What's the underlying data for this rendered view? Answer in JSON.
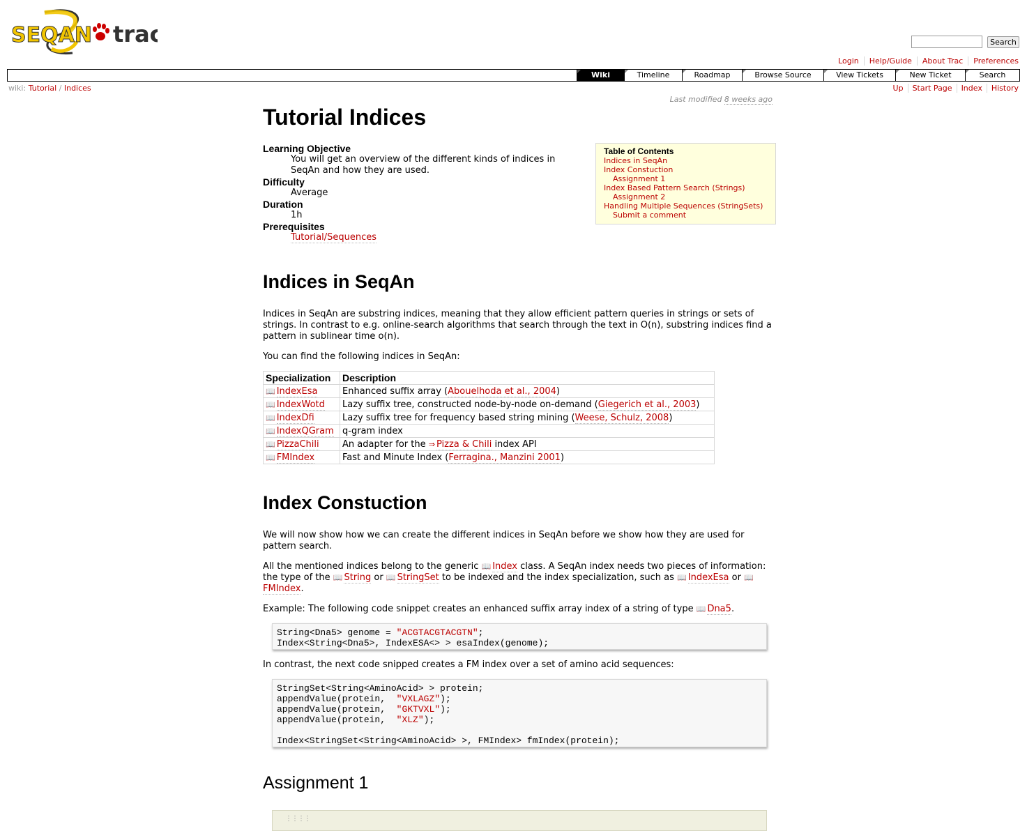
{
  "header": {
    "logo_text_left": "SEQAN",
    "logo_text_right": "trac",
    "search_placeholder": "",
    "search_button": "Search",
    "metanav": [
      "Login",
      "Help/Guide",
      "About Trac",
      "Preferences"
    ]
  },
  "mainnav": [
    {
      "label": "Wiki",
      "active": true
    },
    {
      "label": "Timeline",
      "active": false
    },
    {
      "label": "Roadmap",
      "active": false
    },
    {
      "label": "Browse Source",
      "active": false
    },
    {
      "label": "View Tickets",
      "active": false
    },
    {
      "label": "New Ticket",
      "active": false
    },
    {
      "label": "Search",
      "active": false
    }
  ],
  "breadcrumb": {
    "prefix": "wiki:",
    "items": [
      "Tutorial",
      "Indices"
    ],
    "separator": "/"
  },
  "ctxnav": [
    "Up",
    "Start Page",
    "Index",
    "History"
  ],
  "last_modified": {
    "prefix": "Last modified",
    "ago": "8 weeks ago"
  },
  "page_title": "Tutorial Indices",
  "objectives": [
    {
      "term": "Learning Objective",
      "def": "You will get an overview of the different kinds of indices in SeqAn and how they are used."
    },
    {
      "term": "Difficulty",
      "def": "Average"
    },
    {
      "term": "Duration",
      "def": "1h"
    },
    {
      "term": "Prerequisites",
      "def": "Tutorial/Sequences",
      "link": true
    }
  ],
  "toc": {
    "title": "Table of Contents",
    "items": [
      {
        "label": "Indices in SeqAn",
        "sub": false
      },
      {
        "label": "Index Constuction",
        "sub": false
      },
      {
        "label": "Assignment 1",
        "sub": true
      },
      {
        "label": "Index Based Pattern Search (Strings)",
        "sub": false
      },
      {
        "label": "Assignment 2",
        "sub": true
      },
      {
        "label": "Handling Multiple Sequences (StringSets)",
        "sub": false
      },
      {
        "label": "Submit a comment",
        "sub": true
      }
    ]
  },
  "section1": {
    "heading": "Indices in SeqAn",
    "para1": "Indices in SeqAn are substring indices, meaning that they allow efficient pattern queries in strings or sets of strings. In contrast to e.g. online-search algorithms that search through the text in O(n), substring indices find a pattern in sublinear time o(n).",
    "para2": "You can find the following indices in SeqAn:"
  },
  "table": {
    "headers": [
      "Specialization",
      "Description"
    ],
    "rows": [
      {
        "spec": "IndexEsa",
        "pre": "Enhanced suffix array (",
        "ref": "Abouelhoda et al., 2004",
        "post": ")",
        "ext": false
      },
      {
        "spec": "IndexWotd",
        "pre": "Lazy suffix tree, constructed node-by-node on-demand (",
        "ref": "Giegerich et al., 2003",
        "post": ")",
        "ext": false
      },
      {
        "spec": "IndexDfi",
        "pre": "Lazy suffix tree for frequency based string mining (",
        "ref": "Weese, Schulz, 2008",
        "post": ")",
        "ext": false
      },
      {
        "spec": "IndexQGram",
        "pre": "q-gram index",
        "ref": "",
        "post": "",
        "ext": false
      },
      {
        "spec": "PizzaChili",
        "pre": "An adapter for the ",
        "ref": "Pizza & Chili",
        "post": " index API",
        "ext": true
      },
      {
        "spec": "FMIndex",
        "pre": "Fast and Minute Index (",
        "ref": "Ferragina., Manzini 2001",
        "post": ")",
        "ext": false
      }
    ]
  },
  "section2": {
    "heading": "Index Constuction",
    "para1": "We will now show how we can create the different indices in SeqAn before we show how they are used for pattern search.",
    "para2_a": "All the mentioned indices belong to the generic ",
    "para2_l1": "Index",
    "para2_b": " class. A SeqAn index needs two pieces of information: the type of the ",
    "para2_l2": "String",
    "para2_c": " or ",
    "para2_l3": "StringSet",
    "para2_d": " to be indexed and the index specialization, such as ",
    "para2_l4": "IndexEsa",
    "para2_e": " or ",
    "para2_l5": "FMIndex",
    "para2_f": ".",
    "para3_a": "Example: The following code snippet creates an enhanced suffix array index of a string of type ",
    "para3_l": "Dna5",
    "para3_b": ".",
    "code1": [
      {
        "pre": "String<Dna5> genome = ",
        "str": "\"ACGTACGTACGTN\"",
        "post": ";"
      },
      {
        "pre": "Index<String<Dna5>, IndexESA<> > esaIndex(genome);",
        "str": "",
        "post": ""
      }
    ],
    "para4": "In contrast, the next code snipped creates a FM index over a set of amino acid sequences:",
    "code2": [
      {
        "pre": "StringSet<String<AminoAcid> > protein;",
        "str": "",
        "post": ""
      },
      {
        "pre": "appendValue(protein,  ",
        "str": "\"VXLAGZ\"",
        "post": ");"
      },
      {
        "pre": "appendValue(protein,  ",
        "str": "\"GKTVXL\"",
        "post": ");"
      },
      {
        "pre": "appendValue(protein,  ",
        "str": "\"XLZ\"",
        "post": ");"
      },
      {
        "pre": "",
        "str": "",
        "post": ""
      },
      {
        "pre": "Index<StringSet<String<AminoAcid> >, FMIndex> fmIndex(protein);",
        "str": "",
        "post": ""
      }
    ]
  },
  "section3": {
    "heading": "Assignment 1"
  },
  "colors": {
    "link": "#bb0000",
    "toc_bg": "#ffffdd",
    "code_bg": "#f7f7f7",
    "logo_yellow": "#f2c500"
  }
}
